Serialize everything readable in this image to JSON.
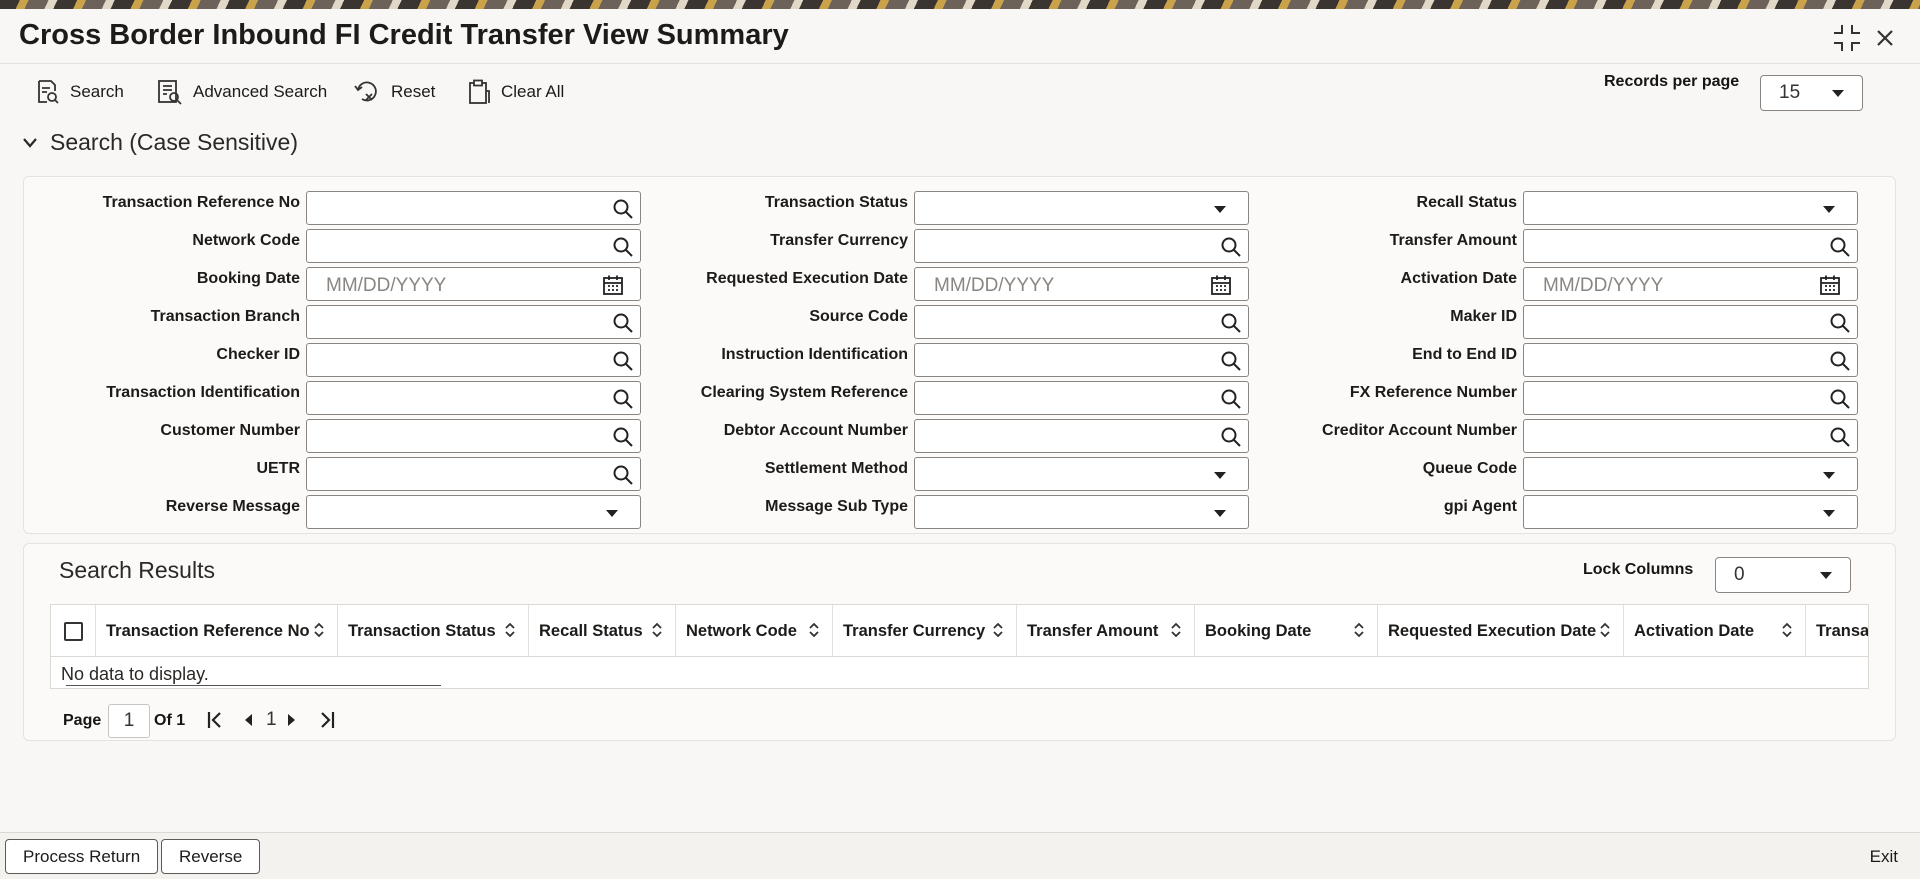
{
  "window": {
    "title": "Cross Border Inbound FI Credit Transfer View Summary"
  },
  "toolbar": {
    "search_label": "Search",
    "advanced_search_label": "Advanced Search",
    "reset_label": "Reset",
    "clear_all_label": "Clear All",
    "records_per_page_label": "Records per page",
    "records_per_page_value": "15"
  },
  "search_section": {
    "title": "Search (Case Sensitive)",
    "date_placeholder": "MM/DD/YYYY",
    "fields": {
      "transaction_reference_no": "Transaction Reference No",
      "transaction_status": "Transaction Status",
      "recall_status": "Recall Status",
      "network_code": "Network Code",
      "transfer_currency": "Transfer Currency",
      "transfer_amount": "Transfer Amount",
      "booking_date": "Booking Date",
      "requested_execution_date": "Requested Execution Date",
      "activation_date": "Activation Date",
      "transaction_branch": "Transaction Branch",
      "source_code": "Source Code",
      "maker_id": "Maker ID",
      "checker_id": "Checker ID",
      "instruction_identification": "Instruction Identification",
      "end_to_end_id": "End to End ID",
      "transaction_identification": "Transaction Identification",
      "clearing_system_reference": "Clearing System Reference",
      "fx_reference_number": "FX Reference Number",
      "customer_number": "Customer Number",
      "debtor_account_number": "Debtor Account Number",
      "creditor_account_number": "Creditor Account Number",
      "uetr": "UETR",
      "settlement_method": "Settlement Method",
      "queue_code": "Queue Code",
      "reverse_message": "Reverse Message",
      "message_sub_type": "Message Sub Type",
      "gpi_agent": "gpi Agent"
    }
  },
  "results": {
    "title": "Search Results",
    "lock_columns_label": "Lock Columns",
    "lock_columns_value": "0",
    "columns": [
      "Transaction Reference No",
      "Transaction Status",
      "Recall Status",
      "Network Code",
      "Transfer Currency",
      "Transfer Amount",
      "Booking Date",
      "Requested Execution Date",
      "Activation Date",
      "Transac"
    ],
    "empty_message": "No data to display."
  },
  "pagination": {
    "page_label": "Page",
    "page_value": "1",
    "of_label": "Of 1",
    "current_page": "1"
  },
  "footer": {
    "process_return_label": "Process Return",
    "reverse_label": "Reverse",
    "exit_label": "Exit"
  }
}
